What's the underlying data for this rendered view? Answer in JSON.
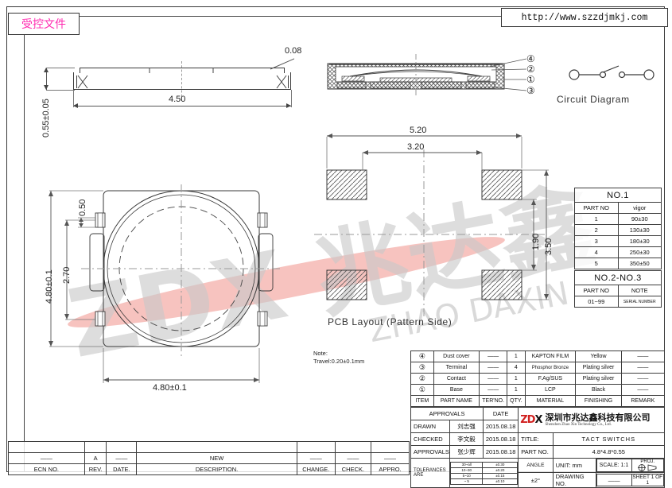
{
  "sheet": {
    "stamp_label": "受控文件",
    "url": "http://www.szzdjmkj.com"
  },
  "watermark": {
    "line1": "ZDX 兆达鑫",
    "line2": "ZHAO DAXIN",
    "color": "#c9c9c9",
    "accent_color": "#f6b9b4"
  },
  "side_view": {
    "width_dim": "4.50",
    "height_dim": "0.55±0.05",
    "chamfer_dim": "0.08"
  },
  "section_view": {
    "callouts": [
      "④",
      "②",
      "①",
      "③"
    ]
  },
  "circuit": {
    "caption": "Circuit  Diagram"
  },
  "top_view": {
    "width_dim": "4.80±0.1",
    "height_dim": "4.80±0.1",
    "pitch_dim": "2.70",
    "pad_dim": "0.50"
  },
  "pcb_layout": {
    "caption": "PCB  Layout  (Pattern  Side)",
    "dim_overall_x": "5.20",
    "dim_inner_x": "3.20",
    "dim_overall_y": "3.50",
    "dim_inner_y": "1.90",
    "note_title": "Note:",
    "note_text": "Travel:0.20±0.1mm"
  },
  "table_no1": {
    "title": "NO.1",
    "headers": [
      "PART  NO",
      "vigor"
    ],
    "rows": [
      [
        "1",
        "90±30"
      ],
      [
        "2",
        "130±30"
      ],
      [
        "3",
        "180±30"
      ],
      [
        "4",
        "250±30"
      ],
      [
        "5",
        "350±50"
      ]
    ]
  },
  "table_no23": {
    "title": "NO.2-NO.3",
    "headers": [
      "PART  NO",
      "NOTE"
    ],
    "rows": [
      [
        "01~99",
        "SERIAL  NUMBER"
      ]
    ]
  },
  "table_materials": {
    "headers": [
      "ITEM",
      "PART  NAME",
      "TER'NO.",
      "QTY.",
      "MATERIAL",
      "FINISHING",
      "REMARK"
    ],
    "rows": [
      [
        "④",
        "Dust cover",
        "——",
        "1",
        "KAPTON  FILM",
        "Yellow",
        "——"
      ],
      [
        "③",
        "Terminal",
        "——",
        "4",
        "Phosphor  Bronze",
        "Plating  silver",
        "——"
      ],
      [
        "②",
        "Contact",
        "——",
        "1",
        "F.Ag/SUS",
        "Plating  silver",
        "——"
      ],
      [
        "①",
        "Base",
        "——",
        "1",
        "LCP",
        "Black",
        "——"
      ]
    ]
  },
  "title_block": {
    "approvals_header": "APPROVALS",
    "date_header": "DATE",
    "rows": [
      {
        "role": "DRAWN",
        "name": "刘志强",
        "date": "2015.08.18"
      },
      {
        "role": "CHECKED",
        "name": "李文毅",
        "date": "2015.08.18"
      },
      {
        "role": "APPROVALS",
        "name": "张少辉",
        "date": "2015.08.18"
      }
    ],
    "tolerances_label": "TOLERANCES  ARE",
    "tolerance_rows": [
      [
        "30~all",
        "±0.30"
      ],
      [
        "10~30",
        "±0.20"
      ],
      [
        "5~10",
        "±0.15"
      ],
      [
        "~ 5",
        "±0.10"
      ]
    ],
    "angle_label": "ANGLE",
    "angle_value": "±2°",
    "company_cn": "深圳市兆达鑫科技有限公司",
    "company_en": "Shenzhen Zhao Xin Technology Co., Ltd.",
    "logo_text_red": "ZD",
    "logo_text_black": "X",
    "title_label": "TITLE:",
    "title_value": "TACT  SWITCHS",
    "part_no_label": "PART  NO.",
    "part_no_value": "4.8*4.8*0.55",
    "unit_label": "UNIT:  mm",
    "scale_label": "SCALE:    1:1",
    "proj_label": "PROJ.",
    "drawing_no_label": "DRAWING  NO.",
    "drawing_no_value": "——",
    "sheet_label": "SHEET    1   OF   1"
  },
  "revision_table": {
    "headers": [
      "ECN  NO.",
      "REV.",
      "DATE.",
      "DESCRIPTION.",
      "CHANGE.",
      "CHECK.",
      "APPRO."
    ],
    "rows": [
      [
        "——",
        "A",
        "——",
        "NEW",
        "——",
        "——",
        "——"
      ],
      [
        "",
        "",
        "",
        "",
        "",
        "",
        ""
      ]
    ]
  }
}
